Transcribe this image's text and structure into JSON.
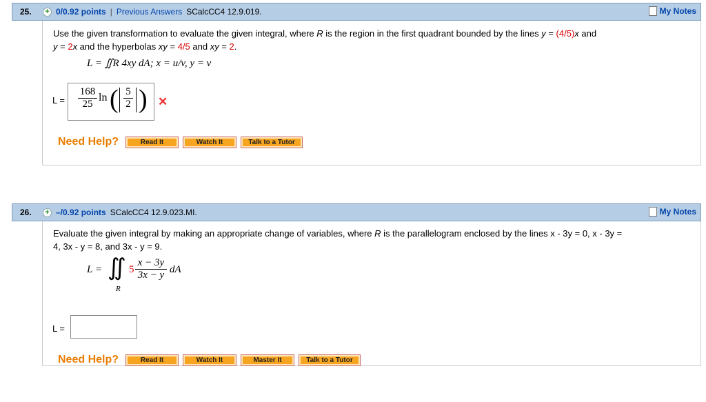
{
  "q25": {
    "number": "25.",
    "points": "0/0.92 points",
    "separator": "|",
    "previous_answers": "Previous Answers",
    "code": "SCalcCC4 12.9.019.",
    "my_notes": "My Notes",
    "text_line1_a": "Use the given transformation to evaluate the given integral, where ",
    "text_R": "R",
    "text_line1_b": " is the region in the first quadrant bounded by the lines ",
    "text_y": "y",
    "text_eq": " = ",
    "text_frac": "(4/5)",
    "text_x": "x",
    "text_and": " and",
    "text_line2_y": "y",
    "text_line2_eq": " = ",
    "text_line2_2x": "2",
    "text_line2_x": "x",
    "text_line2_b": " and the hyperbolas ",
    "text_xy1": "xy",
    "text_eq2": " = ",
    "text_45": "4/5",
    "text_and2": " and ",
    "text_xy2": "xy",
    "text_eq3": " = ",
    "text_2": "2",
    "text_period": ".",
    "formula": "L = ∬R 4xy dA;   x = u/v,  y = v",
    "answer_label": "L =",
    "answer_num": "168",
    "answer_den": "25",
    "answer_ln": "ln",
    "answer_in_num": "5",
    "answer_in_den": "2",
    "wrong_mark": "✕",
    "need_help": "Need Help?",
    "buttons": [
      "Read It",
      "Watch It",
      "Talk to a Tutor"
    ]
  },
  "q26": {
    "number": "26.",
    "points": "–/0.92 points",
    "code": "SCalcCC4 12.9.023.MI.",
    "my_notes": "My Notes",
    "text_a": "Evaluate the given integral by making an appropriate change of variables, where ",
    "text_R": "R",
    "text_b": " is the parallelogram enclosed by the lines ",
    "text_c": "x - 3y = 0, x - 3y =",
    "text_line2": "4, 3x - y = 8, and 3x - y = 9.",
    "formula_L": "L =",
    "formula_coef": "5",
    "formula_num": "x − 3y",
    "formula_den": "3x − y",
    "formula_dA": "dA",
    "formula_R": "R",
    "answer_label": "L =",
    "answer_value": "",
    "need_help": "Need Help?",
    "buttons": [
      "Read It",
      "Watch It",
      "Master It",
      "Talk to a Tutor"
    ]
  }
}
